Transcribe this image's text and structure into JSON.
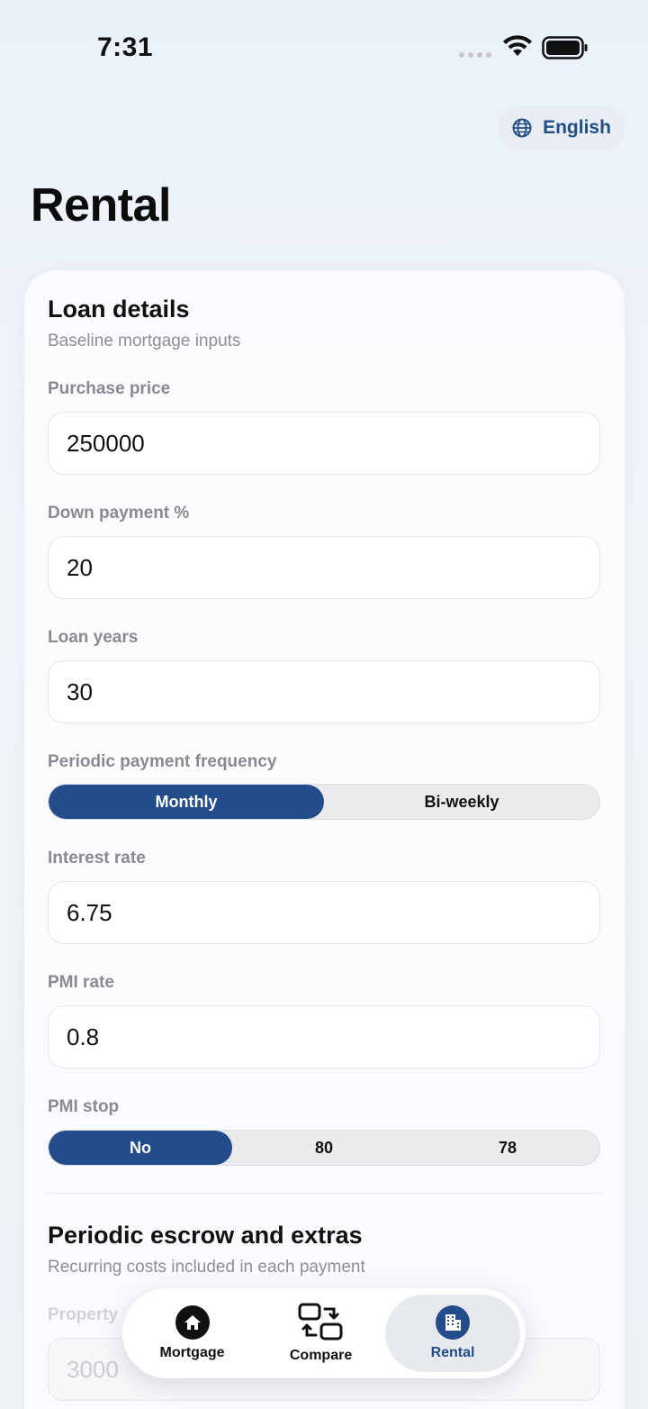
{
  "status": {
    "time": "7:31"
  },
  "language": {
    "label": "English"
  },
  "page": {
    "title": "Rental"
  },
  "loan": {
    "title": "Loan details",
    "subtitle": "Baseline mortgage inputs",
    "purchase_price": {
      "label": "Purchase price",
      "value": "250000"
    },
    "down_payment": {
      "label": "Down payment %",
      "value": "20"
    },
    "loan_years": {
      "label": "Loan years",
      "value": "30"
    },
    "frequency": {
      "label": "Periodic payment frequency",
      "options": [
        "Monthly",
        "Bi-weekly"
      ],
      "selected": "Monthly"
    },
    "interest_rate": {
      "label": "Interest rate",
      "value": "6.75"
    },
    "pmi_rate": {
      "label": "PMI rate",
      "value": "0.8"
    },
    "pmi_stop": {
      "label": "PMI stop",
      "options": [
        "No",
        "80",
        "78"
      ],
      "selected": "No"
    }
  },
  "escrow": {
    "title": "Periodic escrow and extras",
    "subtitle": "Recurring costs included in each payment",
    "property": {
      "label": "Property",
      "value": "3000"
    }
  },
  "tabs": [
    {
      "label": "Mortgage",
      "icon": "house-icon",
      "active": false
    },
    {
      "label": "Compare",
      "icon": "compare-icon",
      "active": false
    },
    {
      "label": "Rental",
      "icon": "building-icon",
      "active": true
    }
  ],
  "colors": {
    "accent": "#234d8a",
    "background": "#eef3f9",
    "card": "#fbfcfe"
  }
}
